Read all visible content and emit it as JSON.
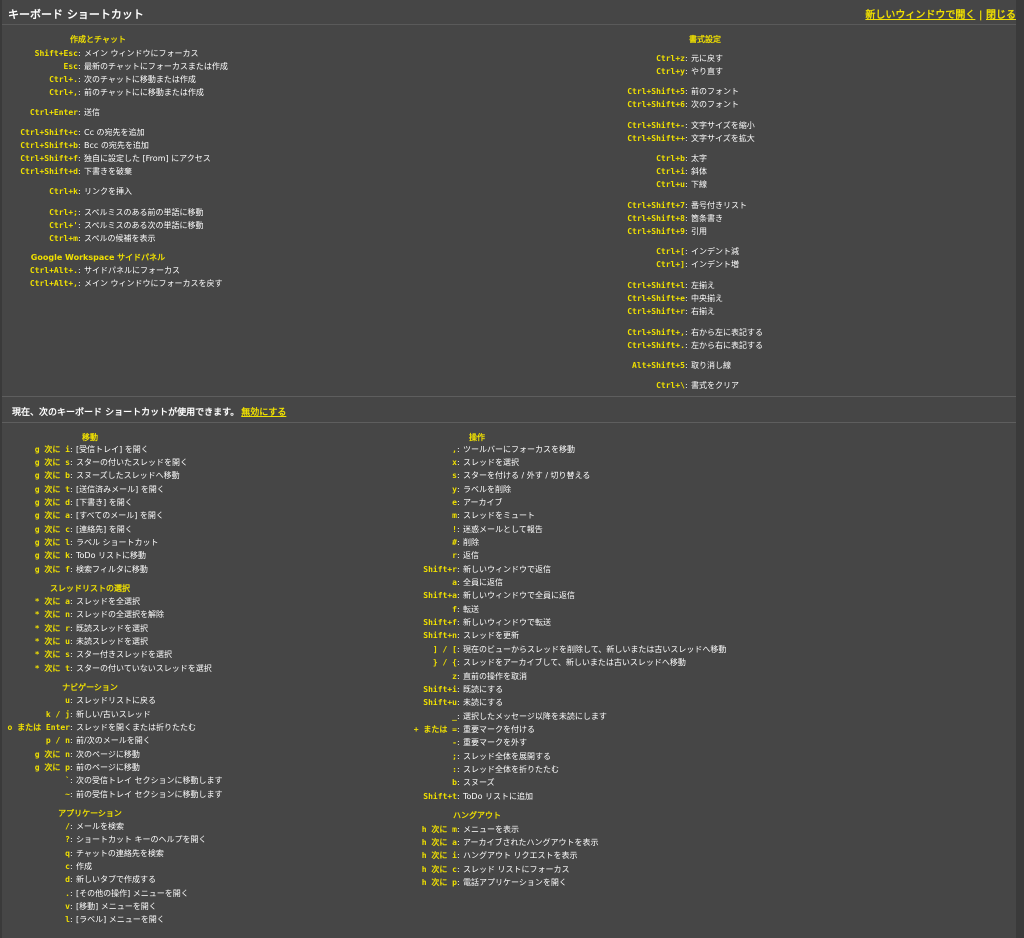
{
  "window": {
    "title": "キーボード ショートカット",
    "open_new_window": "新しいウィンドウで開く",
    "separator": "|",
    "close": "閉じる"
  },
  "status": {
    "text": "現在、次のキーボード ショートカットが使用できます。",
    "disable": "無効にする"
  },
  "top_left": {
    "sections": [
      {
        "title": "作成とチャット",
        "items": [
          {
            "keys": "Shift+Esc",
            "desc": "メイン ウィンドウにフォーカス"
          },
          {
            "keys": "Esc",
            "desc": "最新のチャットにフォーカスまたは作成"
          },
          {
            "keys": "Ctrl+.",
            "desc": "次のチャットに移動または作成"
          },
          {
            "keys": "Ctrl+,",
            "desc": "前のチャットにに移動または作成"
          },
          {
            "keys": "Ctrl+Enter",
            "desc": "送信"
          },
          {
            "keys": "Ctrl+Shift+c",
            "desc": "Cc の宛先を追加"
          },
          {
            "keys": "Ctrl+Shift+b",
            "desc": "Bcc の宛先を追加"
          },
          {
            "keys": "Ctrl+Shift+f",
            "desc": "独自に設定した [From] にアクセス"
          },
          {
            "keys": "Ctrl+Shift+d",
            "desc": "下書きを破棄"
          },
          {
            "keys": "Ctrl+k",
            "desc": "リンクを挿入"
          },
          {
            "keys": "Ctrl+;",
            "desc": "スペルミスのある前の単語に移動"
          },
          {
            "keys": "Ctrl+'",
            "desc": "スペルミスのある次の単語に移動"
          },
          {
            "keys": "Ctrl+m",
            "desc": "スペルの候補を表示"
          }
        ]
      },
      {
        "title": "Google Workspace サイドパネル",
        "items": [
          {
            "keys": "Ctrl+Alt+.",
            "desc": "サイドパネルにフォーカス"
          },
          {
            "keys": "Ctrl+Alt+,",
            "desc": "メイン ウィンドウにフォーカスを戻す"
          }
        ]
      }
    ]
  },
  "top_right": {
    "sections": [
      {
        "title": "書式設定",
        "items": [
          {
            "keys": "Ctrl+z",
            "desc": "元に戻す"
          },
          {
            "keys": "Ctrl+y",
            "desc": "やり直す"
          },
          {
            "keys": "Ctrl+Shift+5",
            "desc": "前のフォント"
          },
          {
            "keys": "Ctrl+Shift+6",
            "desc": "次のフォント"
          },
          {
            "keys": "Ctrl+Shift+-",
            "desc": "文字サイズを縮小"
          },
          {
            "keys": "Ctrl+Shift++",
            "desc": "文字サイズを拡大"
          },
          {
            "keys": "Ctrl+b",
            "desc": "太字"
          },
          {
            "keys": "Ctrl+i",
            "desc": "斜体"
          },
          {
            "keys": "Ctrl+u",
            "desc": "下線"
          },
          {
            "keys": "Ctrl+Shift+7",
            "desc": "番号付きリスト"
          },
          {
            "keys": "Ctrl+Shift+8",
            "desc": "箇条書き"
          },
          {
            "keys": "Ctrl+Shift+9",
            "desc": "引用"
          },
          {
            "keys": "Ctrl+[",
            "desc": "インデント減"
          },
          {
            "keys": "Ctrl+]",
            "desc": "インデント増"
          },
          {
            "keys": "Ctrl+Shift+l",
            "desc": "左揃え"
          },
          {
            "keys": "Ctrl+Shift+e",
            "desc": "中央揃え"
          },
          {
            "keys": "Ctrl+Shift+r",
            "desc": "右揃え"
          },
          {
            "keys": "Ctrl+Shift+,",
            "desc": "右から左に表記する"
          },
          {
            "keys": "Ctrl+Shift+.",
            "desc": "左から右に表記する"
          },
          {
            "keys": "Alt+Shift+5",
            "desc": "取り消し線"
          },
          {
            "keys": "Ctrl+\\",
            "desc": "書式をクリア"
          }
        ]
      }
    ]
  },
  "bottom_left": {
    "sections": [
      {
        "title": "移動",
        "items": [
          {
            "keys": "g 次に i",
            "desc": "[受信トレイ] を開く"
          },
          {
            "keys": "g 次に s",
            "desc": "スターの付いたスレッドを開く"
          },
          {
            "keys": "g 次に b",
            "desc": "スヌーズしたスレッドへ移動"
          },
          {
            "keys": "g 次に t",
            "desc": "[送信済みメール] を開く"
          },
          {
            "keys": "g 次に d",
            "desc": "[下書き] を開く"
          },
          {
            "keys": "g 次に a",
            "desc": "[すべてのメール] を開く"
          },
          {
            "keys": "g 次に c",
            "desc": "[連絡先] を開く"
          },
          {
            "keys": "g 次に l",
            "desc": "ラベル ショートカット"
          },
          {
            "keys": "g 次に k",
            "desc": "ToDo リストに移動"
          },
          {
            "keys": "g 次に f",
            "desc": "検索フィルタに移動"
          }
        ]
      },
      {
        "title": "スレッドリストの選択",
        "items": [
          {
            "keys": "* 次に a",
            "desc": "スレッドを全選択"
          },
          {
            "keys": "* 次に n",
            "desc": "スレッドの全選択を解除"
          },
          {
            "keys": "* 次に r",
            "desc": "既読スレッドを選択"
          },
          {
            "keys": "* 次に u",
            "desc": "未読スレッドを選択"
          },
          {
            "keys": "* 次に s",
            "desc": "スター付きスレッドを選択"
          },
          {
            "keys": "* 次に t",
            "desc": "スターの付いていないスレッドを選択"
          }
        ]
      },
      {
        "title": "ナビゲーション",
        "items": [
          {
            "keys": "u",
            "desc": "スレッドリストに戻る"
          },
          {
            "keys": "k / j",
            "desc": "新しい/古いスレッド"
          },
          {
            "keys": "o または Enter",
            "desc": "スレッドを開くまたは折りたたむ"
          },
          {
            "keys": "p / n",
            "desc": "前/次のメールを開く"
          },
          {
            "keys": "g 次に n",
            "desc": "次のページに移動"
          },
          {
            "keys": "g 次に p",
            "desc": "前のページに移動"
          },
          {
            "keys": "`",
            "desc": "次の受信トレイ セクションに移動します"
          },
          {
            "keys": "~",
            "desc": "前の受信トレイ セクションに移動します"
          }
        ]
      },
      {
        "title": "アプリケーション",
        "items": [
          {
            "keys": "/",
            "desc": "メールを検索"
          },
          {
            "keys": "?",
            "desc": "ショートカット キーのヘルプを開く"
          },
          {
            "keys": "q",
            "desc": "チャットの連絡先を検索"
          },
          {
            "keys": "c",
            "desc": "作成"
          },
          {
            "keys": "d",
            "desc": "新しいタブで作成する"
          },
          {
            "keys": ".",
            "desc": "[その他の操作] メニューを開く"
          },
          {
            "keys": "v",
            "desc": "[移動] メニューを開く"
          },
          {
            "keys": "l",
            "desc": "[ラベル] メニューを開く"
          }
        ]
      }
    ]
  },
  "bottom_right": {
    "sections": [
      {
        "title": "操作",
        "items": [
          {
            "keys": ",",
            "desc": "ツールバーにフォーカスを移動"
          },
          {
            "keys": "x",
            "desc": "スレッドを選択"
          },
          {
            "keys": "s",
            "desc": "スターを付ける / 外す / 切り替える"
          },
          {
            "keys": "y",
            "desc": "ラベルを削除"
          },
          {
            "keys": "e",
            "desc": "アーカイブ"
          },
          {
            "keys": "m",
            "desc": "スレッドをミュート"
          },
          {
            "keys": "!",
            "desc": "迷惑メールとして報告"
          },
          {
            "keys": "#",
            "desc": "削除"
          },
          {
            "keys": "r",
            "desc": "返信"
          },
          {
            "keys": "Shift+r",
            "desc": "新しいウィンドウで返信"
          },
          {
            "keys": "a",
            "desc": "全員に返信"
          },
          {
            "keys": "Shift+a",
            "desc": "新しいウィンドウで全員に返信"
          },
          {
            "keys": "f",
            "desc": "転送"
          },
          {
            "keys": "Shift+f",
            "desc": "新しいウィンドウで転送"
          },
          {
            "keys": "Shift+n",
            "desc": "スレッドを更新"
          },
          {
            "keys": "] / [",
            "desc": "現在のビューからスレッドを削除して、新しいまたは古いスレッドへ移動"
          },
          {
            "keys": "} / {",
            "desc": "スレッドをアーカイブして、新しいまたは古いスレッドへ移動"
          },
          {
            "keys": "z",
            "desc": "直前の操作を取消"
          },
          {
            "keys": "Shift+i",
            "desc": "既読にする"
          },
          {
            "keys": "Shift+u",
            "desc": "未読にする"
          },
          {
            "keys": "_",
            "desc": "選択したメッセージ以降を未読にします"
          },
          {
            "keys": "+ または =",
            "desc": "重要マークを付ける"
          },
          {
            "keys": "-",
            "desc": "重要マークを外す"
          },
          {
            "keys": ";",
            "desc": "スレッド全体を展開する"
          },
          {
            "keys": ":",
            "desc": "スレッド全体を折りたたむ"
          },
          {
            "keys": "b",
            "desc": "スヌーズ"
          },
          {
            "keys": "Shift+t",
            "desc": "ToDo リストに追加"
          }
        ]
      },
      {
        "title": "ハングアウト",
        "items": [
          {
            "keys": "h 次に m",
            "desc": "メニューを表示"
          },
          {
            "keys": "h 次に a",
            "desc": "アーカイブされたハングアウトを表示"
          },
          {
            "keys": "h 次に i",
            "desc": "ハングアウト リクエストを表示"
          },
          {
            "keys": "h 次に c",
            "desc": "スレッド リストにフォーカス"
          },
          {
            "keys": "h 次に p",
            "desc": "電話アプリケーションを開く"
          }
        ]
      }
    ]
  }
}
